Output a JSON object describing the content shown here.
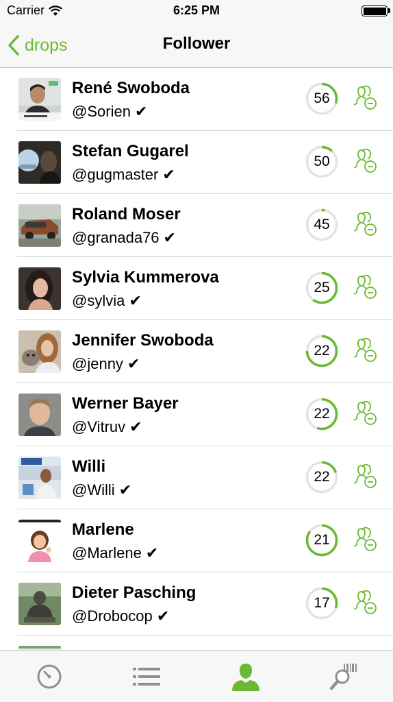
{
  "status_bar": {
    "carrier": "Carrier",
    "time": "6:25 PM"
  },
  "nav": {
    "back_label": "drops",
    "title": "Follower"
  },
  "colors": {
    "accent": "#6ab934",
    "ring_track": "#e3e3e3",
    "tab_inactive": "#8e8e93"
  },
  "followers": [
    {
      "name": "René Swoboda",
      "handle": "@Sorien ✔",
      "score": "56",
      "progress": 0.3
    },
    {
      "name": "Stefan Gugarel",
      "handle": "@gugmaster ✔",
      "score": "50",
      "progress": 0.12
    },
    {
      "name": "Roland Moser",
      "handle": "@granada76 ✔",
      "score": "45",
      "progress": 0.03
    },
    {
      "name": "Sylvia Kummerova",
      "handle": "@sylvia ✔",
      "score": "25",
      "progress": 0.6
    },
    {
      "name": "Jennifer Swoboda",
      "handle": "@jenny ✔",
      "score": "22",
      "progress": 0.75
    },
    {
      "name": "Werner Bayer",
      "handle": "@Vitruv ✔",
      "score": "22",
      "progress": 0.55
    },
    {
      "name": "Willi",
      "handle": "@Willi ✔",
      "score": "22",
      "progress": 0.2
    },
    {
      "name": "Marlene",
      "handle": "@Marlene ✔",
      "score": "21",
      "progress": 0.85
    },
    {
      "name": "Dieter Pasching",
      "handle": "@Drobocop ✔",
      "score": "17",
      "progress": 0.3
    }
  ],
  "tabs": [
    {
      "icon": "clock-icon",
      "active": false
    },
    {
      "icon": "list-icon",
      "active": false
    },
    {
      "icon": "person-icon",
      "active": true
    },
    {
      "icon": "search-barcode-icon",
      "active": false
    }
  ]
}
